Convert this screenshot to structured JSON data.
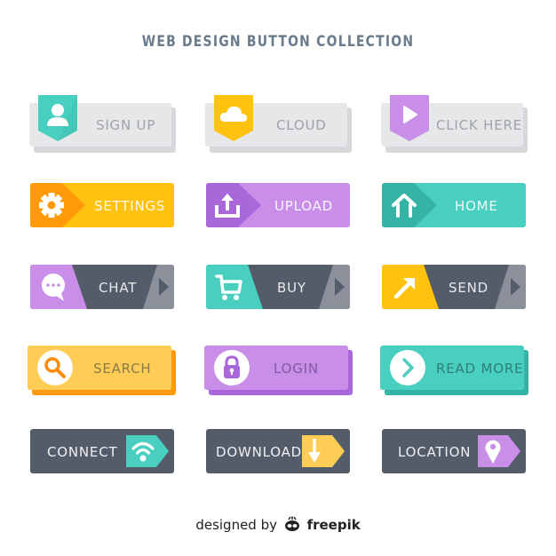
{
  "title": "WEB DESIGN BUTTON COLLECTION",
  "colors": {
    "teal": "#48cfbf",
    "teal_dark": "#35b3a4",
    "yellow": "#ffc20e",
    "orange": "#ff9a0a",
    "purple": "#c98fe8",
    "purple_dark": "#a868d9",
    "gray_light": "#e6e7e9",
    "slate": "#545c69",
    "slate_light": "#8b909a"
  },
  "buttons": {
    "sign_up": {
      "label": "SIGN UP",
      "icon": "user-icon"
    },
    "cloud": {
      "label": "CLOUD",
      "icon": "cloud-icon"
    },
    "click_here": {
      "label": "CLICK HERE",
      "icon": "play-icon"
    },
    "settings": {
      "label": "SETTINGS",
      "icon": "gear-icon"
    },
    "upload": {
      "label": "UPLOAD",
      "icon": "upload-icon"
    },
    "home": {
      "label": "HOME",
      "icon": "home-icon"
    },
    "chat": {
      "label": "CHAT",
      "icon": "chat-bubble-icon"
    },
    "buy": {
      "label": "BUY",
      "icon": "cart-icon"
    },
    "send": {
      "label": "SEND",
      "icon": "arrow-up-right-icon"
    },
    "search": {
      "label": "SEARCH",
      "icon": "search-icon"
    },
    "login": {
      "label": "LOGIN",
      "icon": "lock-icon"
    },
    "read_more": {
      "label": "READ MORE",
      "icon": "chevron-right-icon"
    },
    "connect": {
      "label": "CONNECT",
      "icon": "wifi-icon"
    },
    "download": {
      "label": "DOWNLOAD",
      "icon": "download-icon"
    },
    "location": {
      "label": "LOCATION",
      "icon": "map-pin-icon"
    }
  },
  "footer": {
    "prefix": "designed by",
    "brand": "freepik"
  }
}
